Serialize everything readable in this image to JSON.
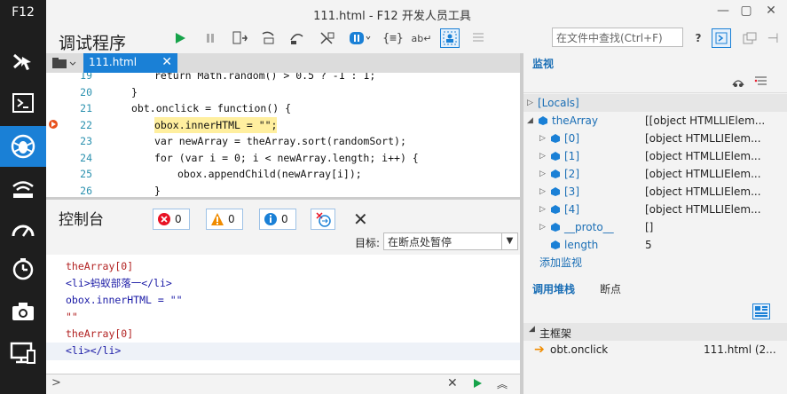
{
  "sidebar": {
    "label": "F12",
    "tools": [
      "dom-explorer",
      "console",
      "debugger",
      "network",
      "performance",
      "memory",
      "emulation",
      "screen"
    ]
  },
  "window": {
    "title": "111.html - F12 开发人员工具",
    "minimize": "—",
    "restore": "▢",
    "close": "✕"
  },
  "toolbar": {
    "name": "调试程序",
    "find_placeholder": "在文件中查找(Ctrl+F)",
    "help": "?"
  },
  "editor": {
    "tab": "111.html",
    "lines": [
      {
        "num": "19",
        "code": "return Math.random() > 0.5 ? -1 : 1;",
        "indent": 3
      },
      {
        "num": "20",
        "code": "}",
        "indent": 2
      },
      {
        "num": "21",
        "code": "obt.onclick = function() {",
        "indent": 2
      },
      {
        "num": "22",
        "code": "obox.innerHTML = \"\";",
        "indent": 3
      },
      {
        "num": "23",
        "code": "var newArray = theArray.sort(randomSort);",
        "indent": 3
      },
      {
        "num": "24",
        "code": "for (var i = 0; i < newArray.length; i++) {",
        "indent": 3
      },
      {
        "num": "25",
        "code": "obox.appendChild(newArray[i]);",
        "indent": 4
      },
      {
        "num": "26",
        "code": "}",
        "indent": 3
      }
    ]
  },
  "console": {
    "title": "控制台",
    "errors": "0",
    "warnings": "0",
    "info": "0",
    "target_label": "目标:",
    "target_value": "在断点处暂停",
    "output": [
      {
        "text": "theArray[0]",
        "color": "#b22222"
      },
      {
        "text": "<li>蚂蚁部落一</li>",
        "color": "#1a1aa6"
      },
      {
        "text": "obox.innerHTML = \"\"",
        "color": "#1a1aa6"
      },
      {
        "text": "\"\"",
        "color": "#b22222"
      },
      {
        "text": "theArray[0]",
        "color": "#b22222"
      },
      {
        "text": "<li></li>",
        "color": "#1a1aa6"
      }
    ],
    "prompt": ">"
  },
  "watch": {
    "title": "监视",
    "rows": [
      {
        "name": "[Locals]",
        "value": "",
        "level": 0,
        "expander": "▷"
      },
      {
        "name": "theArray",
        "value": "[[object HTMLLIElem...",
        "level": 0,
        "expander": "◢"
      },
      {
        "name": "[0]",
        "value": "[object HTMLLIElem...",
        "level": 1,
        "expander": "▷"
      },
      {
        "name": "[1]",
        "value": "[object HTMLLIElem...",
        "level": 1,
        "expander": "▷"
      },
      {
        "name": "[2]",
        "value": "[object HTMLLIElem...",
        "level": 1,
        "expander": "▷"
      },
      {
        "name": "[3]",
        "value": "[object HTMLLIElem...",
        "level": 1,
        "expander": "▷"
      },
      {
        "name": "[4]",
        "value": "[object HTMLLIElem...",
        "level": 1,
        "expander": "▷"
      },
      {
        "name": "__proto__",
        "value": "[]",
        "level": 1,
        "expander": "▷"
      },
      {
        "name": "length",
        "value": "5",
        "level": 1,
        "expander": ""
      }
    ],
    "add_watch": "添加监视"
  },
  "callstack": {
    "tab_active": "调用堆栈",
    "tab_other": "断点",
    "frame_header": "主框架",
    "frame_name": "obt.onclick",
    "frame_loc": "111.html (2..."
  },
  "colors": {
    "accent": "#1a80d6",
    "highlight": "#ffef9f",
    "breakpoint": "#e8501c"
  }
}
